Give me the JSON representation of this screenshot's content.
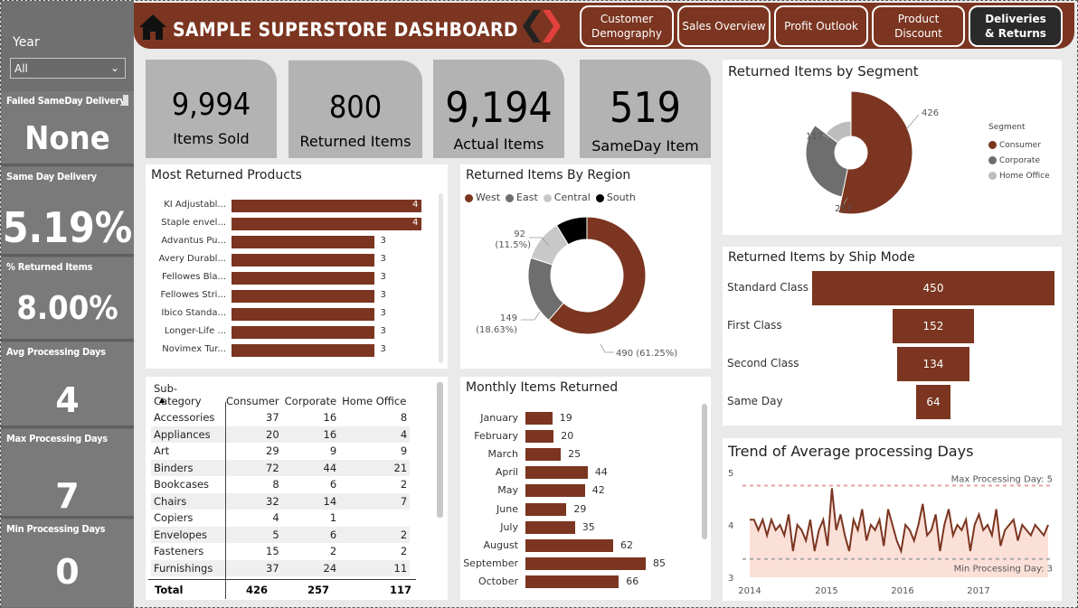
{
  "header": {
    "title": "SAMPLE SUPERSTORE DASHBOARD",
    "home_icon": "home-icon",
    "nav": [
      {
        "label": "Customer Demography",
        "active": false
      },
      {
        "label": "Sales Overview",
        "active": false
      },
      {
        "label": "Profit Outlook",
        "active": false
      },
      {
        "label": "Product Discount",
        "active": false
      },
      {
        "label": "Deliveries & Returns",
        "active": true
      }
    ]
  },
  "sidebar": {
    "year_label": "Year",
    "year_value": "All",
    "metrics": [
      {
        "label": "Failed SameDay Delivery",
        "value": "None"
      },
      {
        "label": "Same Day Delivery",
        "value": "5.19%"
      },
      {
        "label": "% Returned Items",
        "value": "8.00%"
      },
      {
        "label": "Avg Processing Days",
        "value": "4"
      },
      {
        "label": "Max Processing Days",
        "value": "7"
      },
      {
        "label": "Min Processing Days",
        "value": "0"
      }
    ]
  },
  "kpis": [
    {
      "value": "9,994",
      "label": "Items Sold"
    },
    {
      "value": "800",
      "label": "Returned Items"
    },
    {
      "value": "9,194",
      "label": "Actual Items"
    },
    {
      "value": "519",
      "label": "SameDay Item"
    }
  ],
  "colors": {
    "accent": "#7b3520",
    "dark": "#2a2a2a",
    "gray": "#6e6e6e",
    "light_gray": "#bdbdbd"
  },
  "most_returned": {
    "title": "Most Returned Products",
    "items": [
      {
        "label": "KI Adjustabl...",
        "value": 4
      },
      {
        "label": "Staple envel...",
        "value": 4
      },
      {
        "label": "Advantus Pu...",
        "value": 3
      },
      {
        "label": "Avery Durabl...",
        "value": 3
      },
      {
        "label": "Fellowes Bla...",
        "value": 3
      },
      {
        "label": "Fellowes Stri...",
        "value": 3
      },
      {
        "label": "Ibico Standa...",
        "value": 3
      },
      {
        "label": "Longer-Life ...",
        "value": 3
      },
      {
        "label": "Novimex Tur...",
        "value": 3
      }
    ]
  },
  "region": {
    "title": "Returned Items By Region",
    "legend": [
      {
        "name": "West",
        "color": "#7b3520"
      },
      {
        "name": "East",
        "color": "#6e6e6e"
      },
      {
        "name": "Central",
        "color": "#c8c8c8"
      },
      {
        "name": "South",
        "color": "#000000"
      }
    ],
    "labels": [
      {
        "text": "92",
        "sub": "(11.5%)"
      },
      {
        "text": "149",
        "sub": "(18.63%)"
      },
      {
        "text": "490 (61.25%)",
        "sub": ""
      }
    ]
  },
  "segment": {
    "title": "Returned Items by Segment",
    "legend_title": "Segment",
    "legend": [
      {
        "name": "Consumer",
        "color": "#7b3520"
      },
      {
        "name": "Corporate",
        "color": "#6e6e6e"
      },
      {
        "name": "Home Office",
        "color": "#bdbdbd"
      }
    ],
    "labels": [
      "426",
      "257",
      "117"
    ]
  },
  "ship_mode": {
    "title": "Returned Items by Ship Mode",
    "rows": [
      {
        "label": "Standard Class",
        "value": 450
      },
      {
        "label": "First Class",
        "value": 152
      },
      {
        "label": "Second Class",
        "value": 134
      },
      {
        "label": "Same Day",
        "value": 64
      }
    ]
  },
  "matrix": {
    "headers": [
      "Sub-Category",
      "Consumer",
      "Corporate",
      "Home Office"
    ],
    "rows": [
      [
        "Accessories",
        "37",
        "16",
        "8"
      ],
      [
        "Appliances",
        "20",
        "16",
        "4"
      ],
      [
        "Art",
        "29",
        "9",
        "9"
      ],
      [
        "Binders",
        "72",
        "44",
        "21"
      ],
      [
        "Bookcases",
        "8",
        "6",
        "2"
      ],
      [
        "Chairs",
        "32",
        "14",
        "7"
      ],
      [
        "Copiers",
        "4",
        "1",
        ""
      ],
      [
        "Envelopes",
        "5",
        "6",
        "2"
      ],
      [
        "Fasteners",
        "15",
        "2",
        "2"
      ],
      [
        "Furnishings",
        "37",
        "24",
        "11"
      ]
    ],
    "total": [
      "Total",
      "426",
      "257",
      "117"
    ]
  },
  "monthly": {
    "title": "Monthly Items Returned",
    "items": [
      {
        "label": "January",
        "value": 19
      },
      {
        "label": "February",
        "value": 20
      },
      {
        "label": "March",
        "value": 25
      },
      {
        "label": "April",
        "value": 44
      },
      {
        "label": "May",
        "value": 42
      },
      {
        "label": "June",
        "value": 29
      },
      {
        "label": "July",
        "value": 35
      },
      {
        "label": "August",
        "value": 62
      },
      {
        "label": "September",
        "value": 85
      },
      {
        "label": "October",
        "value": 66
      }
    ]
  },
  "chart_data": [
    {
      "type": "bar",
      "title": "Most Returned Products",
      "categories": [
        "KI Adjustabl...",
        "Staple envel...",
        "Advantus Pu...",
        "Avery Durabl...",
        "Fellowes Bla...",
        "Fellowes Stri...",
        "Ibico Standa...",
        "Longer-Life ...",
        "Novimex Tur..."
      ],
      "values": [
        4,
        4,
        3,
        3,
        3,
        3,
        3,
        3,
        3
      ]
    },
    {
      "type": "pie",
      "title": "Returned Items By Region",
      "categories": [
        "West",
        "East",
        "Central",
        "South"
      ],
      "values": [
        490,
        149,
        92,
        69
      ]
    },
    {
      "type": "pie",
      "title": "Returned Items by Segment",
      "categories": [
        "Consumer",
        "Corporate",
        "Home Office"
      ],
      "values": [
        426,
        257,
        117
      ]
    },
    {
      "type": "bar",
      "title": "Returned Items by Ship Mode",
      "categories": [
        "Standard Class",
        "First Class",
        "Second Class",
        "Same Day"
      ],
      "values": [
        450,
        152,
        134,
        64
      ]
    },
    {
      "type": "bar",
      "title": "Monthly Items Returned",
      "categories": [
        "January",
        "February",
        "March",
        "April",
        "May",
        "June",
        "July",
        "August",
        "September",
        "October"
      ],
      "values": [
        19,
        20,
        25,
        44,
        42,
        29,
        35,
        62,
        85,
        66
      ]
    },
    {
      "type": "line",
      "title": "Trend of Average processing Days",
      "x_ticks": [
        "2014",
        "2015",
        "2016",
        "2017"
      ],
      "y_ticks": [
        "5",
        "4",
        "3"
      ],
      "ylim": [
        3,
        5
      ],
      "annotations": [
        "Max Processing Day: 5",
        "Min Processing Day: 3"
      ],
      "values": [
        4.1,
        4.1,
        3.9,
        4.1,
        3.8,
        4.1,
        3.9,
        4.0,
        3.8,
        4.2,
        3.5,
        4.0,
        3.9,
        3.7,
        4.1,
        3.5,
        3.9,
        4.1,
        3.6,
        4.7,
        3.9,
        4.2,
        3.8,
        3.5,
        4.1,
        3.9,
        4.3,
        3.7,
        4.0,
        3.9,
        4.1,
        3.6,
        4.3,
        4.0,
        3.7,
        3.5,
        4.0,
        3.9,
        3.7,
        4.0,
        4.4,
        3.8,
        3.9,
        4.2,
        3.5,
        4.0,
        4.3,
        3.8,
        4.0,
        3.9,
        4.1,
        3.5,
        4.0,
        4.2,
        3.9,
        4.0,
        3.8,
        4.3,
        3.6,
        3.9,
        4.0,
        4.1,
        3.7,
        4.0,
        3.9,
        3.8,
        4.0,
        3.9,
        3.8,
        4.0
      ]
    }
  ]
}
